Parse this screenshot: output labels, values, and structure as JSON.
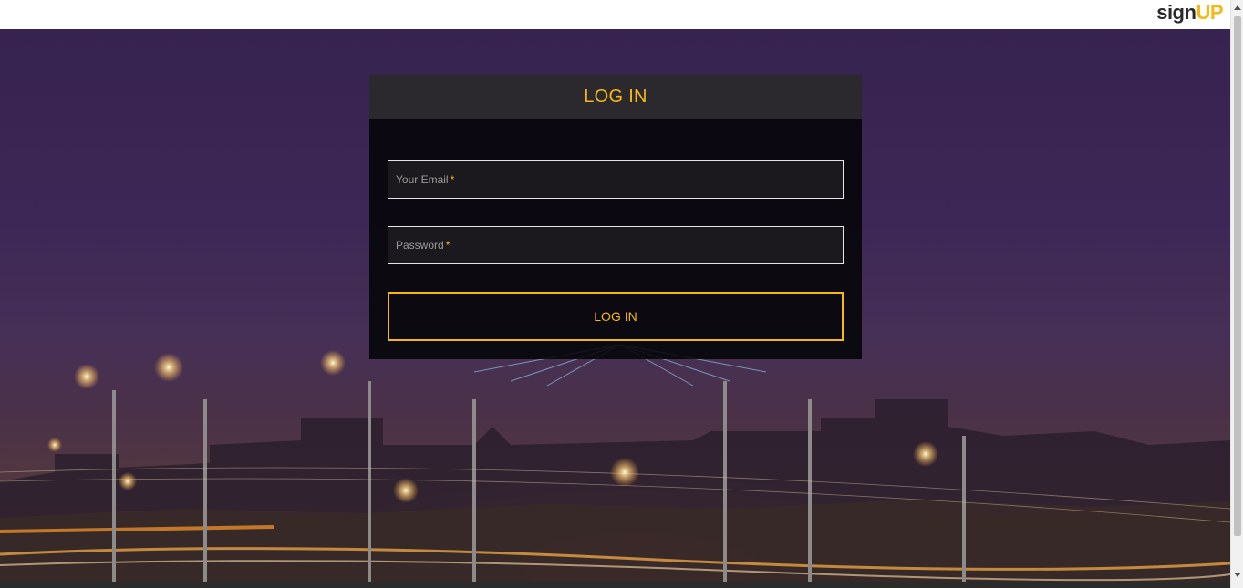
{
  "brand": {
    "logo_text_main": "sign",
    "logo_text_accent": "UP"
  },
  "login": {
    "title": "LOG IN",
    "email_label": "Your Email",
    "password_label": "Password",
    "required_marker": "*",
    "submit_label": "LOG IN"
  },
  "colors": {
    "accent": "#f5b915",
    "panel_header": "#2b292d",
    "panel_body": "#050508"
  }
}
